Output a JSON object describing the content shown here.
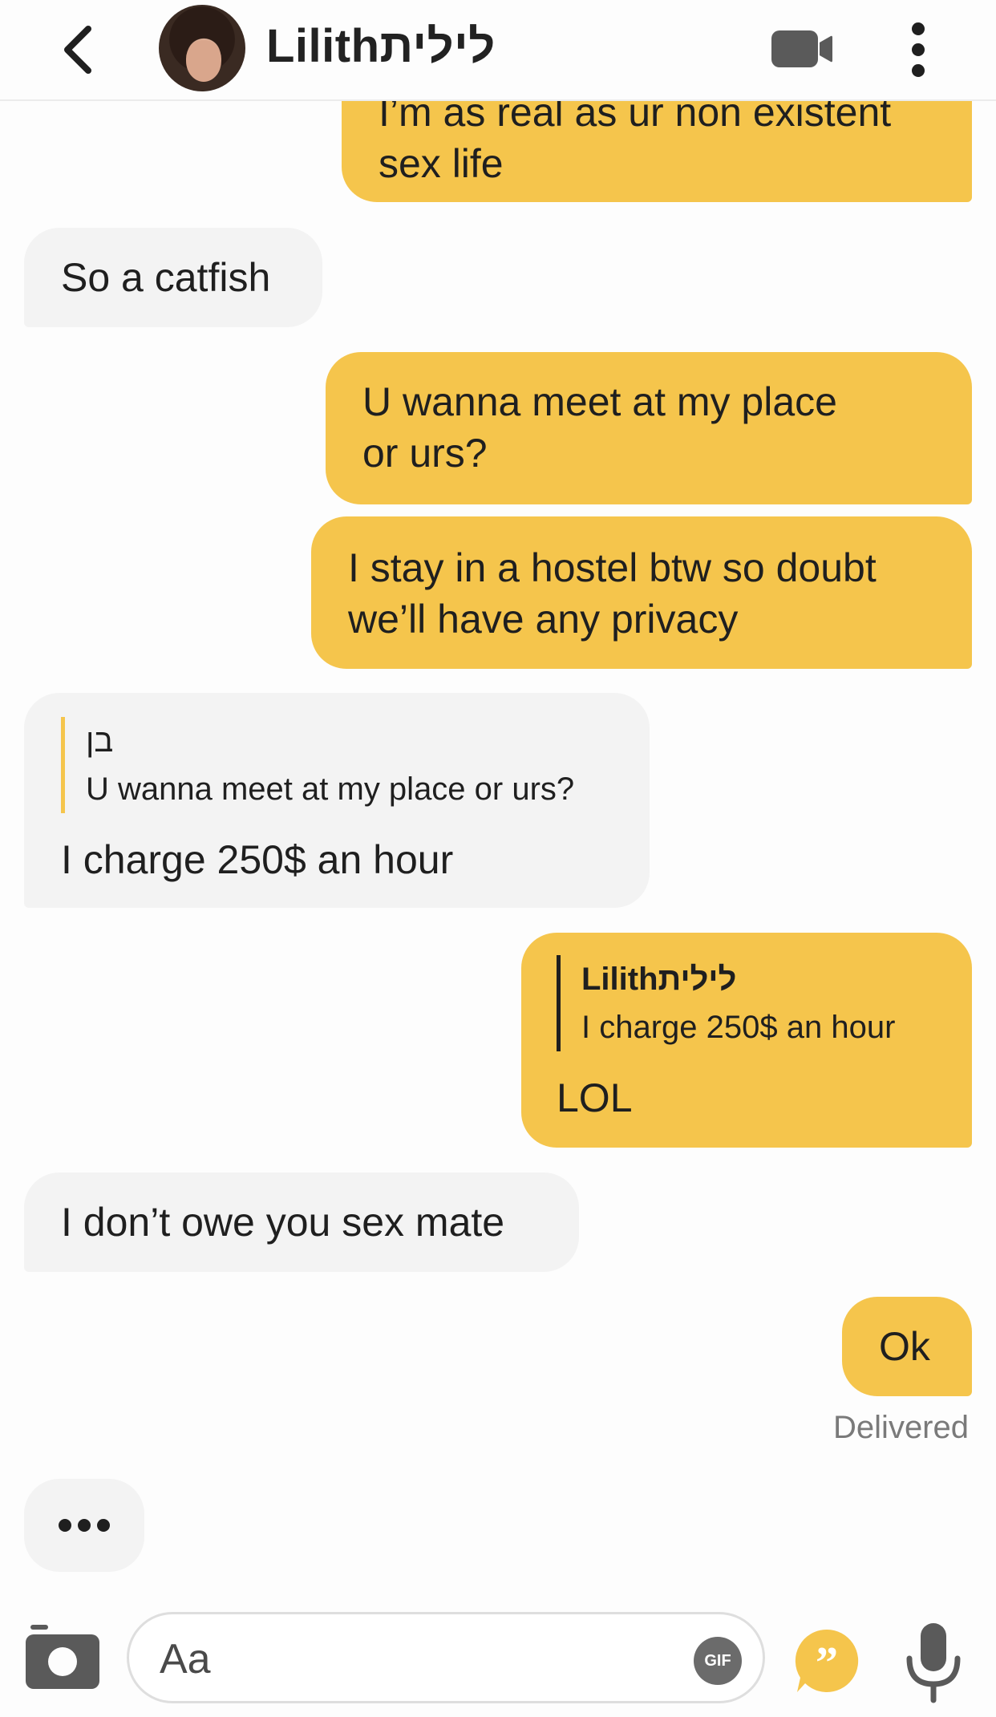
{
  "header": {
    "contact_name": "Lilithלילית",
    "icons": {
      "back": "chevron-left-icon",
      "video": "video-camera-icon",
      "more": "more-vertical-icon"
    }
  },
  "colors": {
    "sent_bubble": "#f5c54c",
    "received_bubble": "#f3f3f3",
    "accent": "#f5c54c"
  },
  "messages": [
    {
      "direction": "sent",
      "text_lines": [
        "I’m as real as ur non existent",
        "sex life"
      ]
    },
    {
      "direction": "received",
      "text": "So a catfish"
    },
    {
      "direction": "sent",
      "text_lines": [
        "U wanna meet at my place",
        "or urs?"
      ]
    },
    {
      "direction": "sent",
      "text_lines": [
        "I stay in a hostel btw so doubt",
        "we’ll have any privacy"
      ]
    },
    {
      "direction": "received",
      "reply_author": "בן",
      "reply_text": "U wanna meet at my place or urs?",
      "text": "I charge 250$ an hour"
    },
    {
      "direction": "sent",
      "reply_author": "Lilithלילית",
      "reply_text": "I charge 250$ an hour",
      "text": "LOL"
    },
    {
      "direction": "received",
      "text": "I don’t owe you sex mate"
    },
    {
      "direction": "sent",
      "text": "Ok"
    }
  ],
  "status": {
    "delivered": "Delivered"
  },
  "composer": {
    "placeholder": "Aa",
    "gif_label": "GIF"
  }
}
